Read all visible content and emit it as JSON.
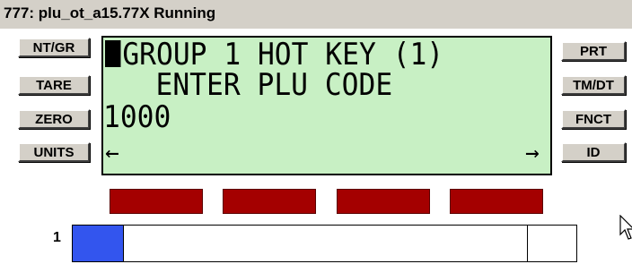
{
  "window": {
    "title": "777: plu_ot_a15.77X Running"
  },
  "left_buttons": [
    {
      "label": "NT/GR"
    },
    {
      "label": "TARE"
    },
    {
      "label": "ZERO"
    },
    {
      "label": "UNITS"
    }
  ],
  "right_buttons": [
    {
      "label": "PRT"
    },
    {
      "label": "TM/DT"
    },
    {
      "label": "FNCT"
    },
    {
      "label": "ID"
    }
  ],
  "display": {
    "line1": "GROUP 1 HOT KEY (1)",
    "line2": "   ENTER PLU CODE",
    "line3": "1000",
    "left_arrow": "←",
    "right_arrow": "→"
  },
  "indicators": {
    "count": 4,
    "color": "#a40000"
  },
  "progress": {
    "label": "1",
    "fill_fraction": 0.1,
    "fill_color": "#3355ee"
  },
  "colors": {
    "lcd_background": "#c8f0c4",
    "button_face": "#d4d0c8"
  }
}
